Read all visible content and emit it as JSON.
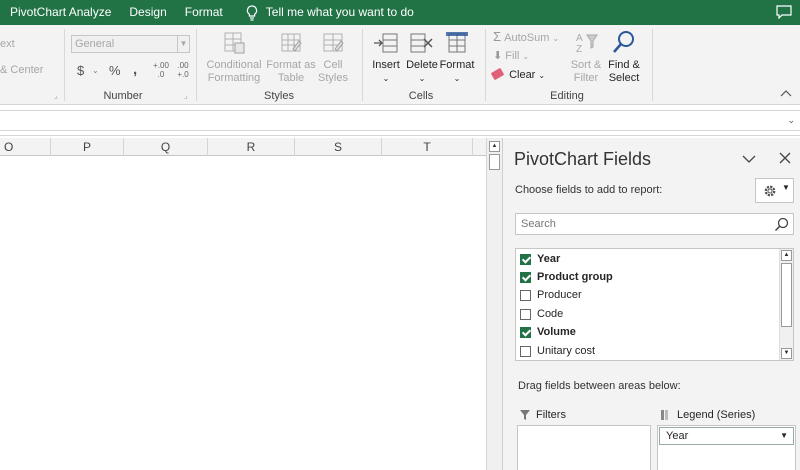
{
  "tabs": {
    "items": [
      "PivotChart Analyze",
      "Design",
      "Format"
    ],
    "tell_me": "Tell me what you want to do"
  },
  "ribbon": {
    "alignment_partial": {
      "text": "ext",
      "center": "& Center"
    },
    "number": {
      "format_value": "General",
      "currency": "$",
      "percent": "%",
      "comma": ",",
      "increase_decimal": "+.00 .0",
      "decrease_decimal": ".00 +.0",
      "label": "Number"
    },
    "styles": {
      "conditional_formatting": [
        "Conditional",
        "Formatting"
      ],
      "format_as_table": [
        "Format as",
        "Table"
      ],
      "cell_styles": [
        "Cell",
        "Styles"
      ],
      "label": "Styles"
    },
    "cells": {
      "insert": "Insert",
      "delete": "Delete",
      "format": "Format",
      "label": "Cells"
    },
    "editing": {
      "autosum": "AutoSum",
      "fill": "Fill",
      "clear": "Clear",
      "sort_filter": [
        "Sort &",
        "Filter"
      ],
      "find_select": [
        "Find &",
        "Select"
      ],
      "label": "Editing"
    }
  },
  "columns": [
    "O",
    "P",
    "Q",
    "R",
    "S",
    "T"
  ],
  "pane": {
    "title": "PivotChart Fields",
    "subtitle": "Choose fields to add to report:",
    "search_placeholder": "Search",
    "fields": [
      {
        "label": "Year",
        "checked": true
      },
      {
        "label": "Product group",
        "checked": true
      },
      {
        "label": "Producer",
        "checked": false
      },
      {
        "label": "Code",
        "checked": false
      },
      {
        "label": "Volume",
        "checked": true
      },
      {
        "label": "Unitary cost",
        "checked": false
      }
    ],
    "drag_hint": "Drag fields between areas below:",
    "filters_label": "Filters",
    "legend_label": "Legend (Series)",
    "legend_items": [
      "Year"
    ]
  },
  "colors": {
    "ribbon_green": "#217346",
    "check_green": "#217346"
  }
}
